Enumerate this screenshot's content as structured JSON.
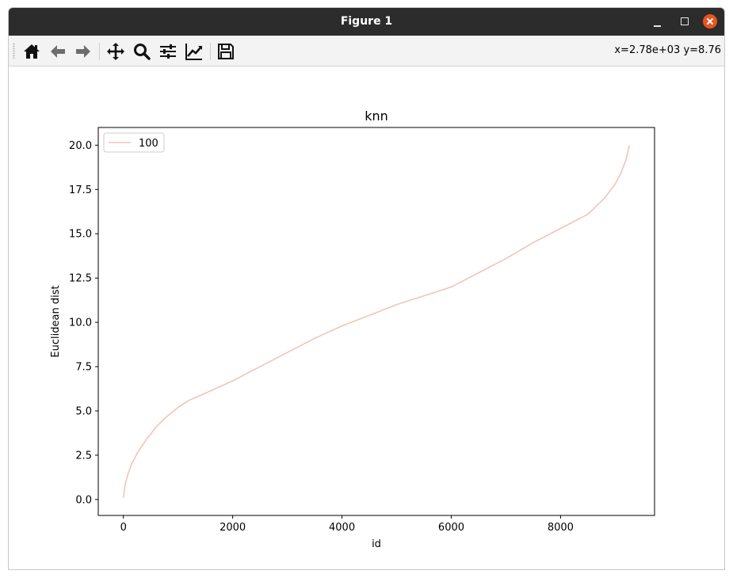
{
  "window": {
    "title": "Figure 1"
  },
  "toolbar": {
    "buttons": [
      {
        "icon": "home-icon"
      },
      {
        "icon": "back-arrow-icon"
      },
      {
        "icon": "forward-arrow-icon"
      },
      {
        "icon": "pan-move-icon"
      },
      {
        "icon": "zoom-magnifier-icon"
      },
      {
        "icon": "subplots-sliders-icon"
      },
      {
        "icon": "edit-axes-icon"
      },
      {
        "icon": "save-floppy-icon"
      }
    ],
    "coordinates": "x=2.78e+03 y=8.76"
  },
  "chart_data": {
    "type": "line",
    "title": "knn",
    "xlabel": "id",
    "ylabel": "Euclidean dist",
    "xlim": [
      -460,
      9720
    ],
    "ylim": [
      -0.9,
      21.0
    ],
    "xticks": [
      0,
      2000,
      4000,
      6000,
      8000
    ],
    "xtick_labels": [
      "0",
      "2000",
      "4000",
      "6000",
      "8000"
    ],
    "yticks": [
      0.0,
      2.5,
      5.0,
      7.5,
      10.0,
      12.5,
      15.0,
      17.5,
      20.0
    ],
    "ytick_labels": [
      "0.0",
      "2.5",
      "5.0",
      "7.5",
      "10.0",
      "12.5",
      "15.0",
      "17.5",
      "20.0"
    ],
    "grid": false,
    "legend_position": "upper left",
    "series": [
      {
        "name": "100",
        "color": "#efc5b8",
        "x": [
          0,
          30,
          80,
          150,
          250,
          400,
          600,
          800,
          1000,
          1200,
          1500,
          2000,
          2500,
          3000,
          3500,
          4000,
          4500,
          5000,
          5500,
          6000,
          6500,
          7000,
          7500,
          8000,
          8500,
          8800,
          9000,
          9100,
          9200,
          9260
        ],
        "y": [
          0.1,
          0.8,
          1.4,
          2.0,
          2.6,
          3.3,
          4.1,
          4.7,
          5.2,
          5.6,
          6.0,
          6.7,
          7.5,
          8.3,
          9.1,
          9.8,
          10.4,
          11.0,
          11.5,
          12.0,
          12.8,
          13.6,
          14.5,
          15.3,
          16.1,
          17.0,
          17.8,
          18.4,
          19.2,
          20.0
        ]
      }
    ]
  }
}
